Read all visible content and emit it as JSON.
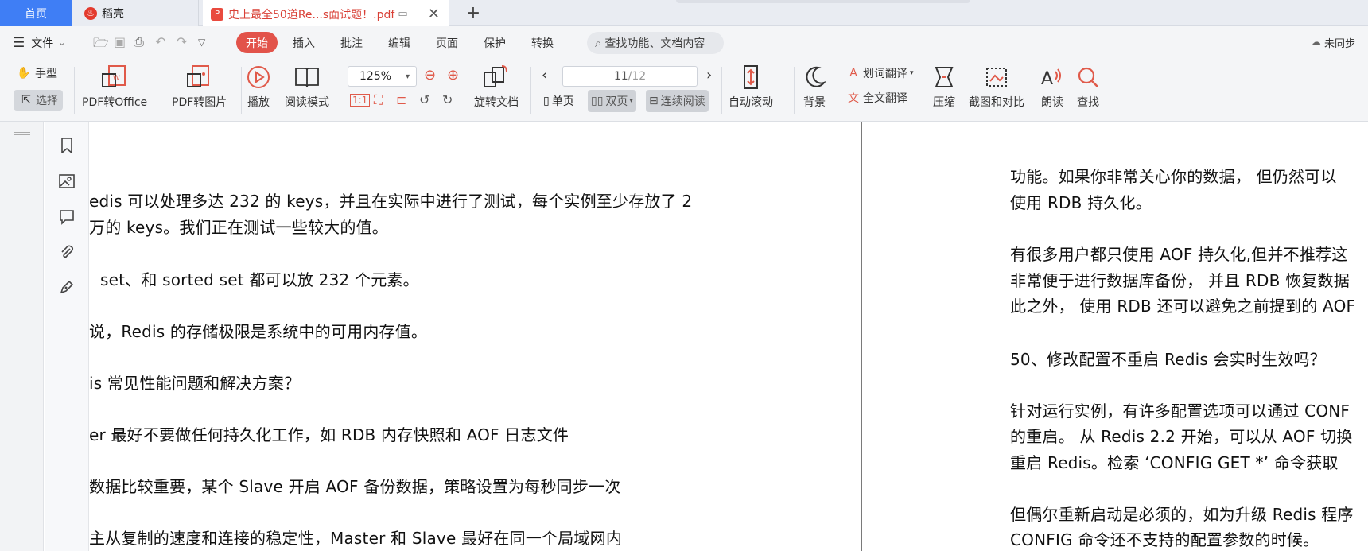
{
  "tabs": {
    "home": "首页",
    "daoke": "稻壳",
    "doc_title": "史上最全50道Re...s面试题！.pdf"
  },
  "menu": {
    "file": "文件",
    "tabs": [
      "开始",
      "插入",
      "批注",
      "编辑",
      "页面",
      "保护",
      "转换"
    ],
    "search_placeholder": "查找功能、文档内容",
    "sync": "未同步"
  },
  "ribbon": {
    "hand": "手型",
    "select": "选择",
    "pdf_to_office": "PDF转Office",
    "pdf_to_image": "PDF转图片",
    "play": "播放",
    "read_mode": "阅读模式",
    "zoom": "125%",
    "rotate": "旋转文档",
    "page_current": "11",
    "page_total": "/12",
    "single": "单页",
    "double": "双页",
    "continuous": "连续阅读",
    "auto_scroll": "自动滚动",
    "background": "背景",
    "word_translate": "划词翻译",
    "full_translate": "全文翻译",
    "compress": "压缩",
    "screenshot_compare": "截图和对比",
    "read_aloud": "朗读",
    "find": "查找"
  },
  "document": {
    "left_lines": [
      "edis 可以处理多达 232 的 keys，并且在实际中进行了测试，每个实例至少存放了 2",
      "万的 keys。我们正在测试一些较大的值。",
      "set、和 sorted set 都可以放 232 个元素。",
      "说，Redis 的存储极限是系统中的可用内存值。",
      "is 常见性能问题和解决方案？",
      "er 最好不要做任何持久化工作，如 RDB 内存快照和 AOF 日志文件",
      "数据比较重要，某个 Slave 开启 AOF 备份数据，策略设置为每秒同步一次",
      "主从复制的速度和连接的稳定性，Master 和 Slave 最好在同一个局域网内"
    ],
    "right_lines": [
      "功能。如果你非常关心你的数据，  但仍然可以",
      "使用 RDB 持久化。",
      "有很多用户都只使用 AOF 持久化,但并不推荐这",
      "非常便于进行数据库备份，  并且  RDB  恢复数据",
      "此之外，  使用 RDB 还可以避免之前提到的 AOF",
      "50、修改配置不重启 Redis 会实时生效吗？",
      "针对运行实例，有许多配置选项可以通过  CONF",
      "的重启。  从  Redis 2.2  开始，可以从  AOF  切换",
      "重启  Redis。检索  ‘CONFIG GET *’  命令获取",
      "但偶尔重新启动是必须的，如为升级  Redis  程序",
      "CONFIG  命令还不支持的配置参数的时候。"
    ]
  }
}
